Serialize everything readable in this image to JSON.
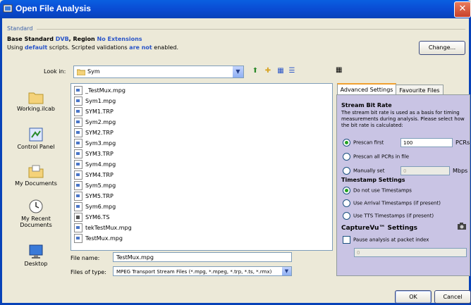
{
  "window": {
    "title": "Open File Analysis",
    "close_label": "✕"
  },
  "standard": {
    "legend": "Standard",
    "line1": {
      "prefix": "Base Standard ",
      "standard": "DVB",
      "mid": ", Region ",
      "region": "No Extensions"
    },
    "line2": {
      "prefix": "Using ",
      "scripts": "default",
      "mid": " scripts. Scripted validations ",
      "state": "are not",
      "suffix": " enabled."
    },
    "change_label": "Change..."
  },
  "lookin": {
    "label": "Look in:",
    "value": "Sym"
  },
  "places": [
    {
      "label": "Working.ilcab",
      "icon": "folder-icon"
    },
    {
      "label": "Control Panel",
      "icon": "control-panel-icon"
    },
    {
      "label": "My Documents",
      "icon": "my-documents-icon"
    },
    {
      "label": "My Recent Documents",
      "icon": "recent-documents-icon"
    },
    {
      "label": "Desktop",
      "icon": "desktop-icon"
    }
  ],
  "files": [
    "_TestMux.mpg",
    "Sym1.mpg",
    "SYM1.TRP",
    "Sym2.mpg",
    "SYM2.TRP",
    "Sym3.mpg",
    "SYM3.TRP",
    "Sym4.mpg",
    "SYM4.TRP",
    "Sym5.mpg",
    "SYM5.TRP",
    "Sym6.mpg",
    "SYM6.TS",
    "tekTestMux.mpg",
    "TestMux.mpg"
  ],
  "filename": {
    "label": "File name:",
    "value": "TestMux.mpg"
  },
  "filetype": {
    "label": "Files of type:",
    "value": "MPEG Transport Stream Files (*.mpg, *.mpeg, *.trp, *.ts, *.rmx)"
  },
  "tabs": {
    "advanced": "Advanced Settings",
    "favourite": "Favourite Files"
  },
  "advanced": {
    "bitrate_heading": "Stream Bit Rate",
    "bitrate_desc": "The stream bit rate is used as a basis for timing measurements during analysis. Please select how the bit rate is calculated:",
    "prescan_first": "Prescan first",
    "prescan_value": "100",
    "prescan_unit": "PCRs",
    "prescan_all": "Prescan all PCRs in file",
    "manually_set": "Manually set",
    "manual_value": "0",
    "manual_unit": "Mbps",
    "timestamp_heading": "Timestamp Settings",
    "ts_none": "Do not use Timestamps",
    "ts_arrival": "Use Arrival Timestamps (if present)",
    "ts_tts": "Use TTS Timestamps (if present)",
    "capturevu_heading": "CaptureVu™ Settings",
    "pause_label": "Pause analysis at packet index",
    "pause_value": "0"
  },
  "buttons": {
    "ok": "OK",
    "cancel": "Cancel"
  },
  "colors": {
    "titlebar": "#0a4cd4",
    "panel_bg": "#c9c4e4",
    "accent_text": "#2a55c8"
  }
}
